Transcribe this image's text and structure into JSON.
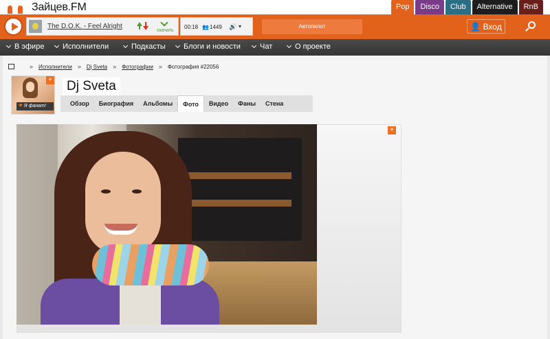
{
  "site": {
    "title": "Зайцев.FM"
  },
  "genres": [
    {
      "label": "Pop",
      "color": "#e2611b"
    },
    {
      "label": "Disco",
      "color": "#7a3c88"
    },
    {
      "label": "Club",
      "color": "#2a6f86"
    },
    {
      "label": "Alternative",
      "color": "#1d1d1d"
    },
    {
      "label": "RnB",
      "color": "#6b1f1a"
    }
  ],
  "player": {
    "track_title": "The D.O.K. - Feel Alright",
    "download_label": "скачать",
    "time": "00:18",
    "listeners": "1449",
    "autopilot_label": "Автопилот",
    "login_label": "Вход"
  },
  "nav": {
    "items": [
      {
        "label": "В эфире"
      },
      {
        "label": "Исполнители"
      },
      {
        "label": "Подкасты"
      },
      {
        "label": "Блоги и новости"
      },
      {
        "label": "Чат"
      },
      {
        "label": "О проекте"
      }
    ]
  },
  "breadcrumb": {
    "items": [
      "Исполнители",
      "Dj Sveta",
      "Фотографии",
      "Фотография #22056"
    ]
  },
  "artist": {
    "name": "Dj Sveta",
    "fan_label": "Я фанат!",
    "plus": "+"
  },
  "tabs": [
    {
      "label": "Обзор"
    },
    {
      "label": "Биография"
    },
    {
      "label": "Альбомы"
    },
    {
      "label": "Фото"
    },
    {
      "label": "Видео"
    },
    {
      "label": "Фаны"
    },
    {
      "label": "Стена"
    }
  ],
  "colors": {
    "brand_orange": "#e2611b",
    "nav_dark": "#3a3a3a"
  }
}
